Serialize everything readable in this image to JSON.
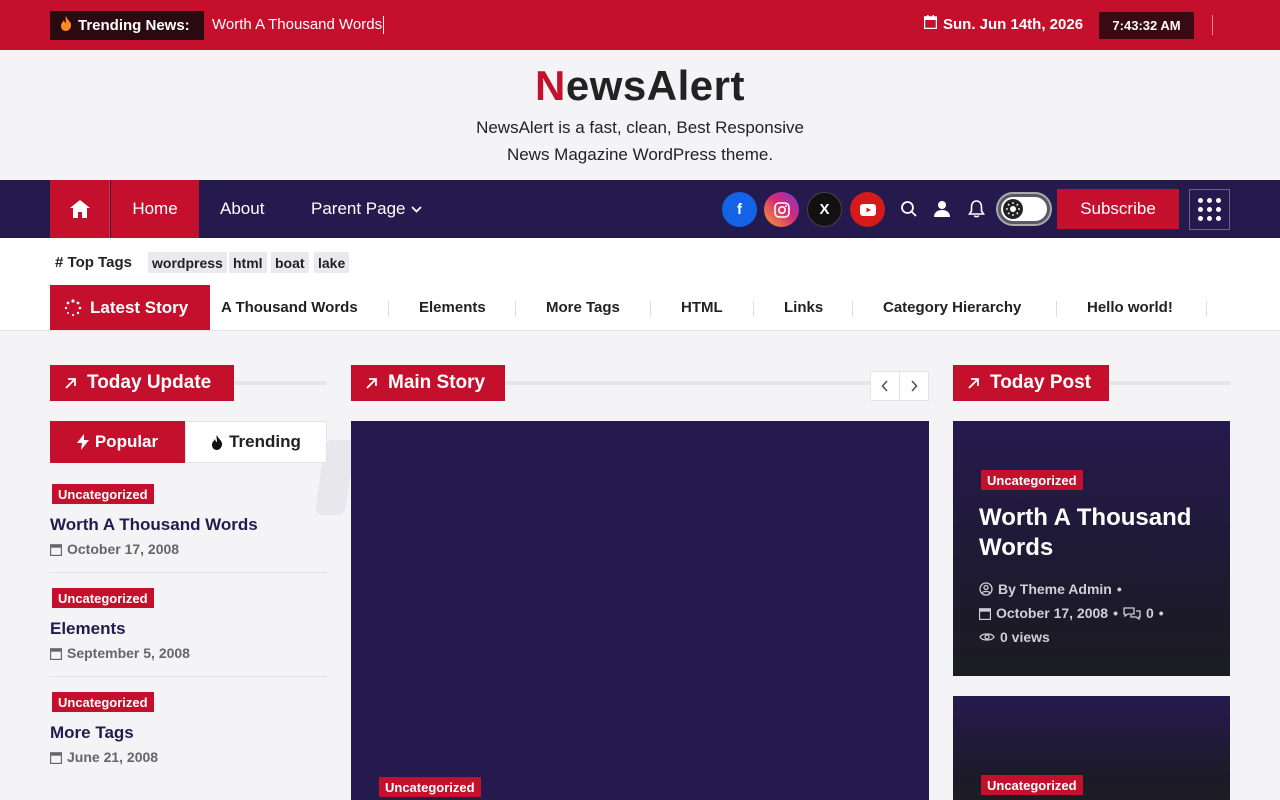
{
  "topbar": {
    "trending_label": "Trending News:",
    "trending_text": "Worth A Thousand Words",
    "date": "Sun. Jun 14th, 2026",
    "time": "7:43:32 AM"
  },
  "header": {
    "logo_first": "N",
    "logo_rest": "ewsAlert",
    "tagline_line1": "NewsAlert is a fast, clean, Best Responsive",
    "tagline_line2": "News Magazine WordPress theme."
  },
  "nav": {
    "home": "Home",
    "about": "About",
    "parent": "Parent Page",
    "subscribe": "Subscribe",
    "social": {
      "fb": "f",
      "x": "X"
    }
  },
  "tags": {
    "label": "Top Tags",
    "items": [
      "wordpress",
      "html",
      "boat",
      "lake"
    ]
  },
  "latest": {
    "label": "Latest Story",
    "items": [
      "A Thousand Words",
      "Elements",
      "More Tags",
      "HTML",
      "Links",
      "Category Hierarchy",
      "Hello world!"
    ]
  },
  "sections": {
    "today_update": "Today Update",
    "main_story": "Main Story",
    "today_post": "Today Post"
  },
  "tabs": {
    "popular": "Popular",
    "trending": "Trending"
  },
  "popular_posts": [
    {
      "category": "Uncategorized",
      "title": "Worth A Thousand Words",
      "date": "October 17, 2008"
    },
    {
      "category": "Uncategorized",
      "title": "Elements",
      "date": "September 5, 2008"
    },
    {
      "category": "Uncategorized",
      "title": "More Tags",
      "date": "June 21, 2008"
    }
  ],
  "main_story": {
    "category": "Uncategorized"
  },
  "today_posts": [
    {
      "category": "Uncategorized",
      "title": "Worth A Thousand Words",
      "author": "By Theme Admin",
      "date": "October 17, 2008",
      "comments": "0",
      "views": "0 views"
    },
    {
      "category": "Uncategorized"
    }
  ],
  "colors": {
    "primary": "#c4102c",
    "navy": "#251a4e"
  }
}
